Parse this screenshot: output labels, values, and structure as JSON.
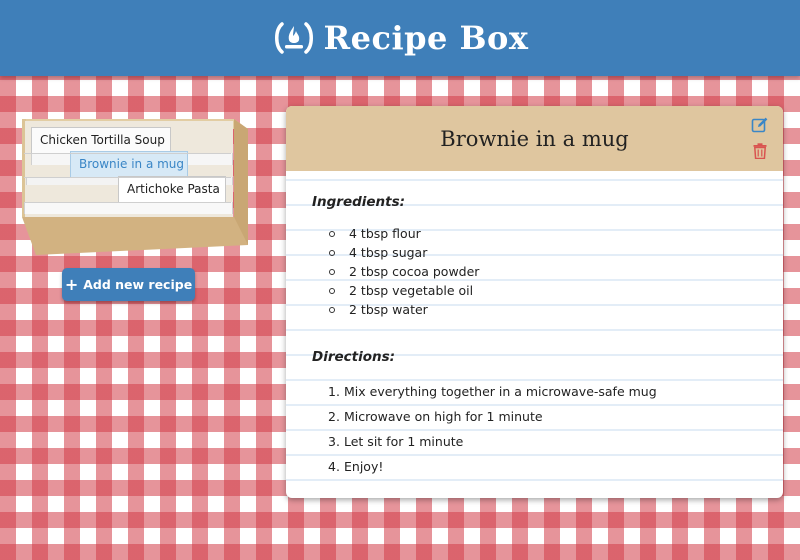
{
  "header": {
    "title": "Recipe Box",
    "logo_icon": "campfire-icon"
  },
  "recipe_box": {
    "recipes": [
      {
        "label": "Chicken Tortilla Soup",
        "selected": false
      },
      {
        "label": "Brownie in a mug",
        "selected": true
      },
      {
        "label": "Artichoke Pasta",
        "selected": false
      }
    ],
    "add_button_label": "Add new recipe",
    "add_button_icon": "plus-icon"
  },
  "recipe": {
    "title": "Brownie in a mug",
    "edit_icon": "edit-icon",
    "delete_icon": "trash-icon",
    "ingredients_heading": "Ingredients:",
    "ingredients": [
      "4 tbsp flour",
      "4 tbsp sugar",
      "2 tbsp cocoa powder",
      "2 tbsp vegetable oil",
      "2 tbsp water"
    ],
    "directions_heading": "Directions:",
    "directions": [
      {
        "num": "1.",
        "text": "Mix everything together in a microwave-safe mug"
      },
      {
        "num": "2.",
        "text": "Microwave on high for 1 minute"
      },
      {
        "num": "3.",
        "text": "Let sit for 1 minute"
      },
      {
        "num": "4.",
        "text": "Enjoy!"
      }
    ]
  },
  "colors": {
    "header_bg": "#3f7fb9",
    "tablecloth": "#d23c48",
    "recipe_header_bg": "#dfc69f",
    "box_wood": "#d6b98a",
    "selected_tab": "#d7e9f6",
    "icon_blue": "#3a86c6",
    "icon_red": "#d9534f"
  }
}
